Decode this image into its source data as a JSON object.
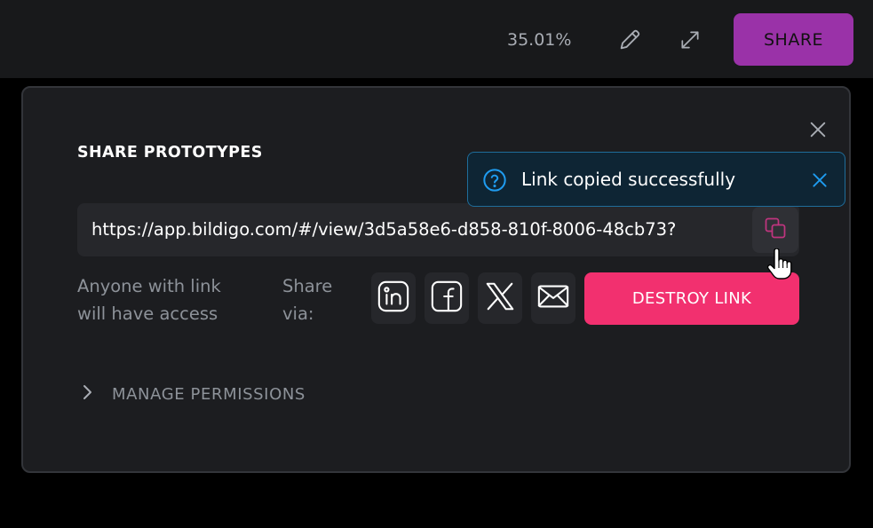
{
  "header": {
    "zoom_level": "35.01%",
    "share_label": "SHARE",
    "edit_icon": "pencil-icon",
    "expand_icon": "expand-icon"
  },
  "dialog": {
    "title": "SHARE PROTOTYPES",
    "url": "https://app.bildigo.com/#/view/3d5a58e6-d858-810f-8006-48cb73?",
    "access_note": "Anyone with link will have access",
    "share_via_label": "Share via:",
    "destroy_label": "DESTROY LINK",
    "manage_permissions_label": "MANAGE PERMISSIONS",
    "social": [
      "linkedin-icon",
      "facebook-icon",
      "x-twitter-icon",
      "mail-icon"
    ]
  },
  "toast": {
    "message": "Link copied successfully"
  },
  "colors": {
    "accent_purple": "#9a32a8",
    "destroy_pink": "#f2306f",
    "toast_blue": "#1f9cf0",
    "copy_icon_pink": "#c0347f"
  }
}
